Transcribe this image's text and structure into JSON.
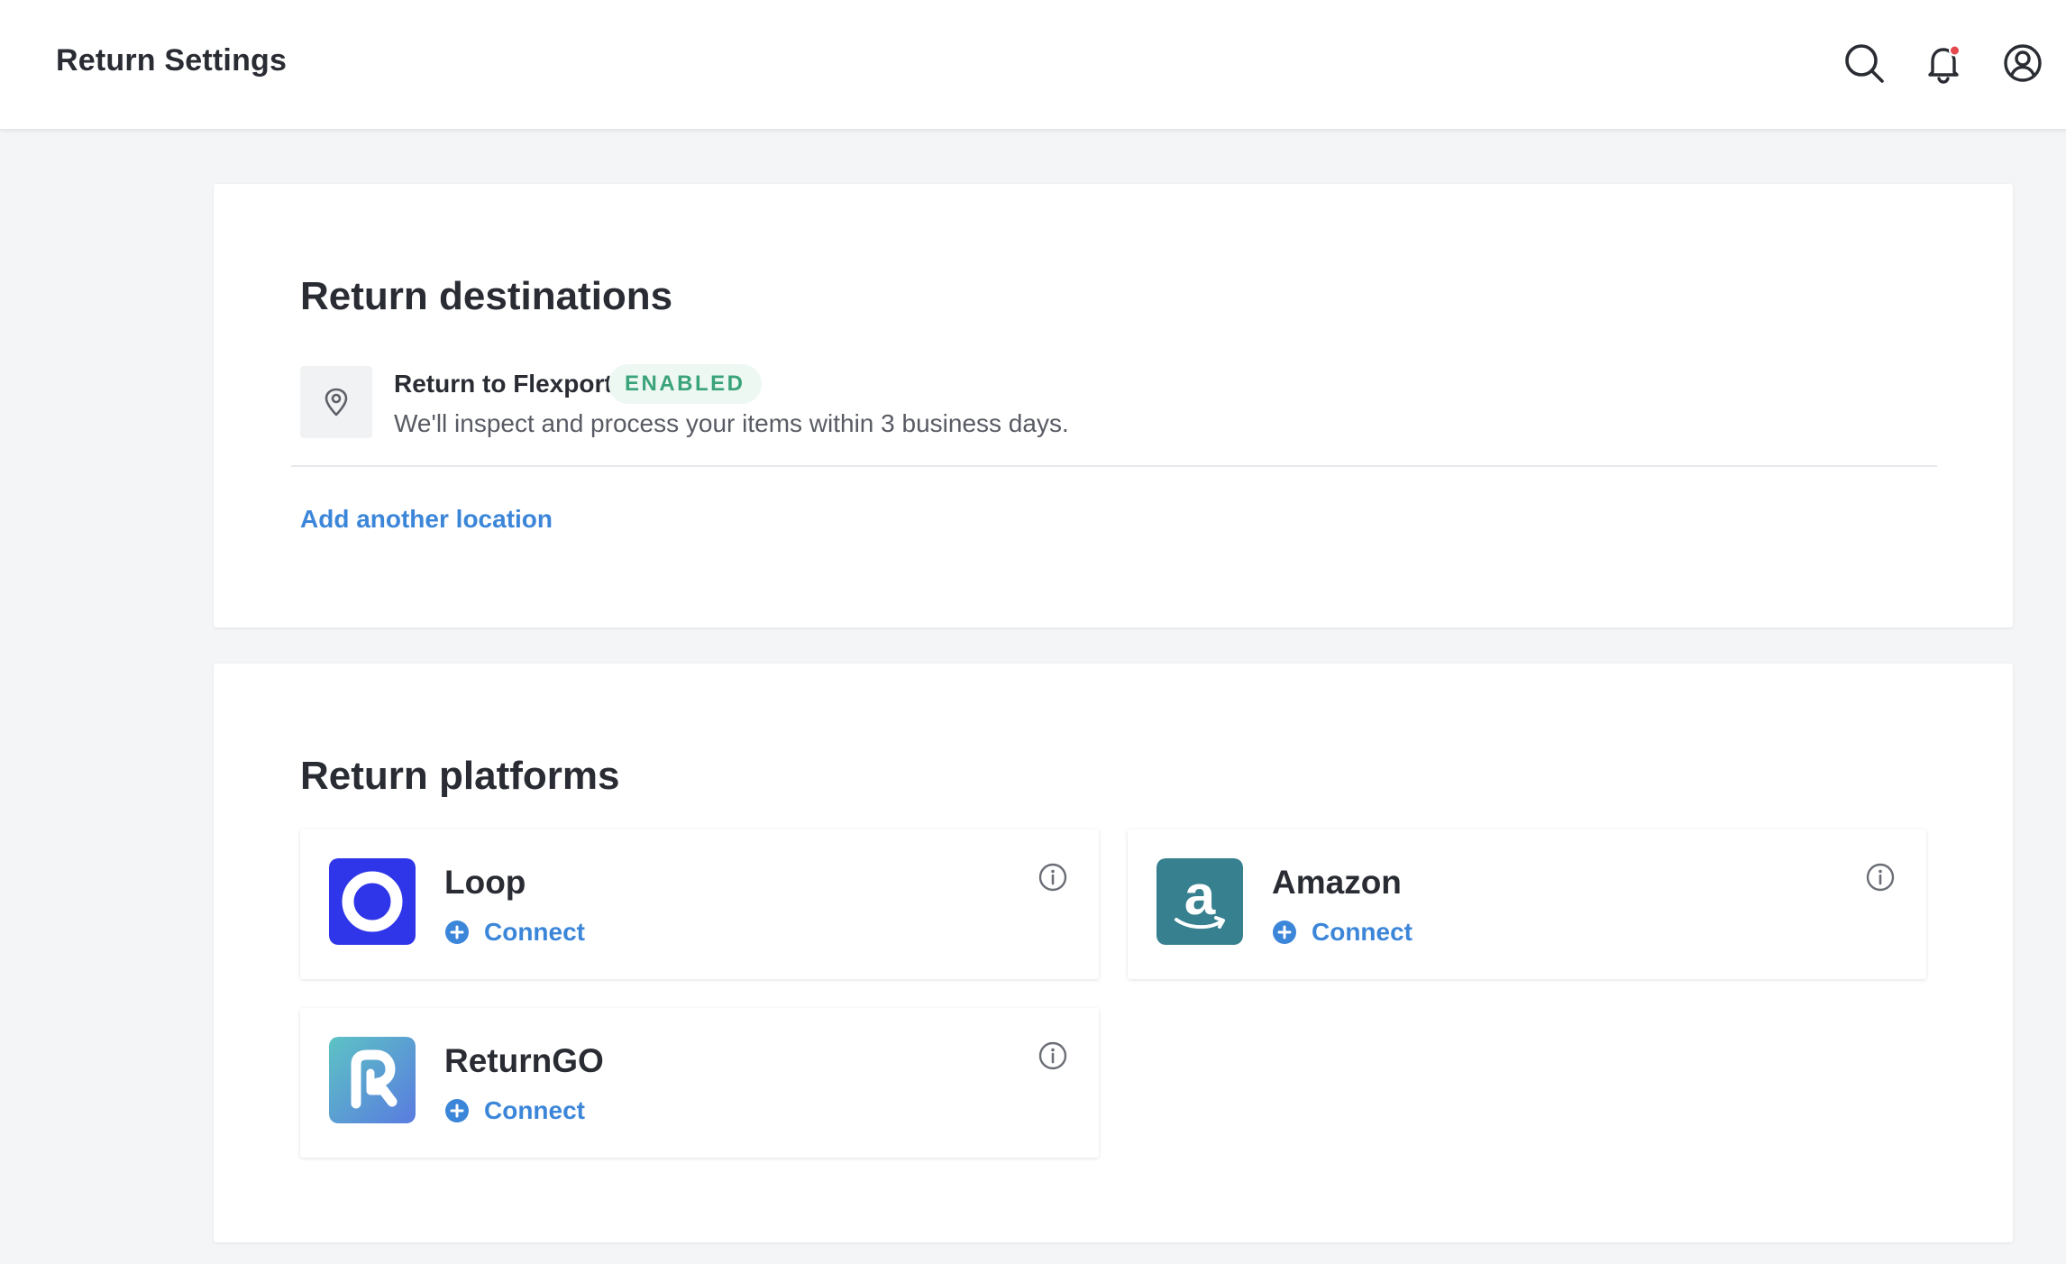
{
  "header": {
    "title": "Return Settings",
    "icons": [
      "search-icon",
      "bell-icon",
      "account-icon"
    ],
    "notification_dot_color": "#e5484d"
  },
  "destinations": {
    "title": "Return destinations",
    "items": [
      {
        "name": "Return to Flexport",
        "status": "ENABLED",
        "description": "We'll inspect and process your items within 3 business days.",
        "icon": "location-pin-icon"
      }
    ],
    "add_label": "Add another location"
  },
  "platforms": {
    "title": "Return platforms",
    "items": [
      {
        "name": "Loop",
        "connect_label": "Connect",
        "logo": "loop-logo",
        "brand_color": "#2f35e8"
      },
      {
        "name": "Amazon",
        "connect_label": "Connect",
        "logo": "amazon-logo",
        "brand_color": "#37808f"
      },
      {
        "name": "ReturnGO",
        "connect_label": "Connect",
        "logo": "returngo-logo",
        "brand_color": "#4fb3c9"
      }
    ]
  },
  "colors": {
    "accent": "#3c86d9",
    "enabled_text": "#3aa37a",
    "enabled_bg": "#eef8f3",
    "background": "#f4f5f7"
  }
}
